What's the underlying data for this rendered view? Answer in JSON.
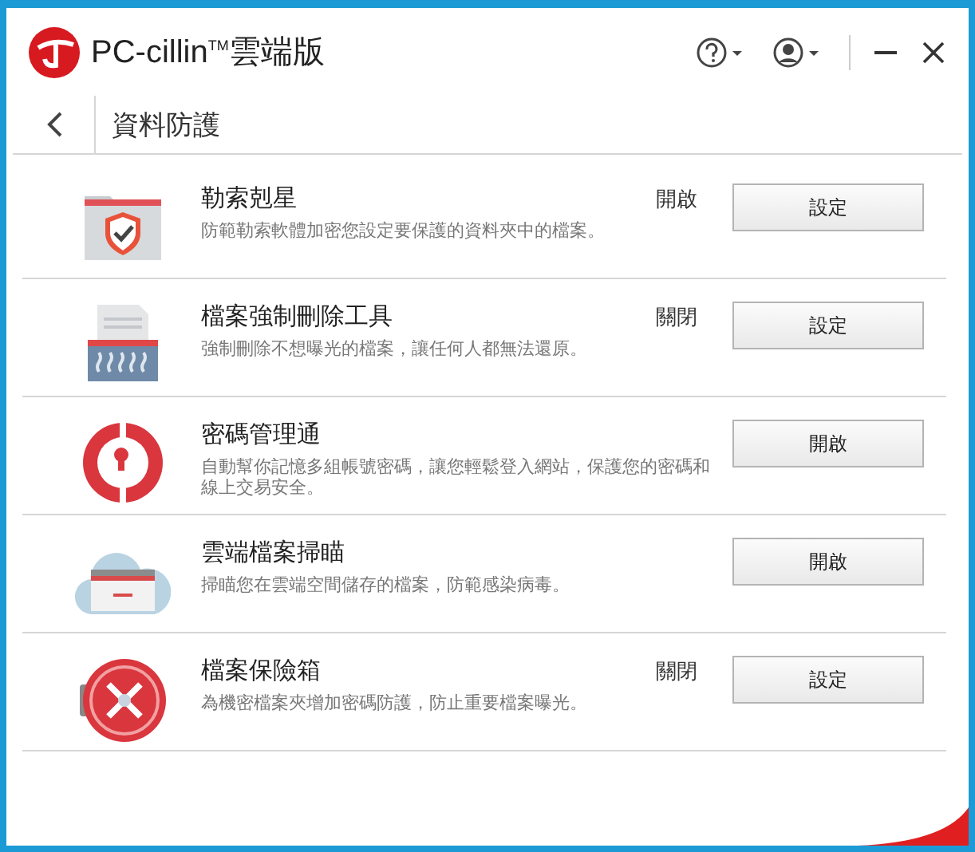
{
  "window": {
    "title": "PC-cillin",
    "title_mark": "TM",
    "title_suffix": "雲端版"
  },
  "nav": {
    "title": "資料防護"
  },
  "features": [
    {
      "kind": "folder-shield",
      "name": "勒索剋星",
      "description": "防範勒索軟體加密您設定要保護的資料夾中的檔案。",
      "status": "開啟",
      "button": "設定"
    },
    {
      "kind": "shredder",
      "name": "檔案強制刪除工具",
      "description": "強制刪除不想曝光的檔案，讓任何人都無法還原。",
      "status": "關閉",
      "button": "設定"
    },
    {
      "kind": "password",
      "name": "密碼管理通",
      "description": "自動幫你記憶多組帳號密碼，讓您輕鬆登入網站，保護您的密碼和線上交易安全。",
      "button": "開啟"
    },
    {
      "kind": "cloud",
      "name": "雲端檔案掃瞄",
      "description": "掃瞄您在雲端空間儲存的檔案，防範感染病毒。",
      "button": "開啟"
    },
    {
      "kind": "vault",
      "name": "檔案保險箱",
      "description": "為機密檔案夾增加密碼防護，防止重要檔案曝光。",
      "status": "關閉",
      "button": "設定"
    }
  ]
}
